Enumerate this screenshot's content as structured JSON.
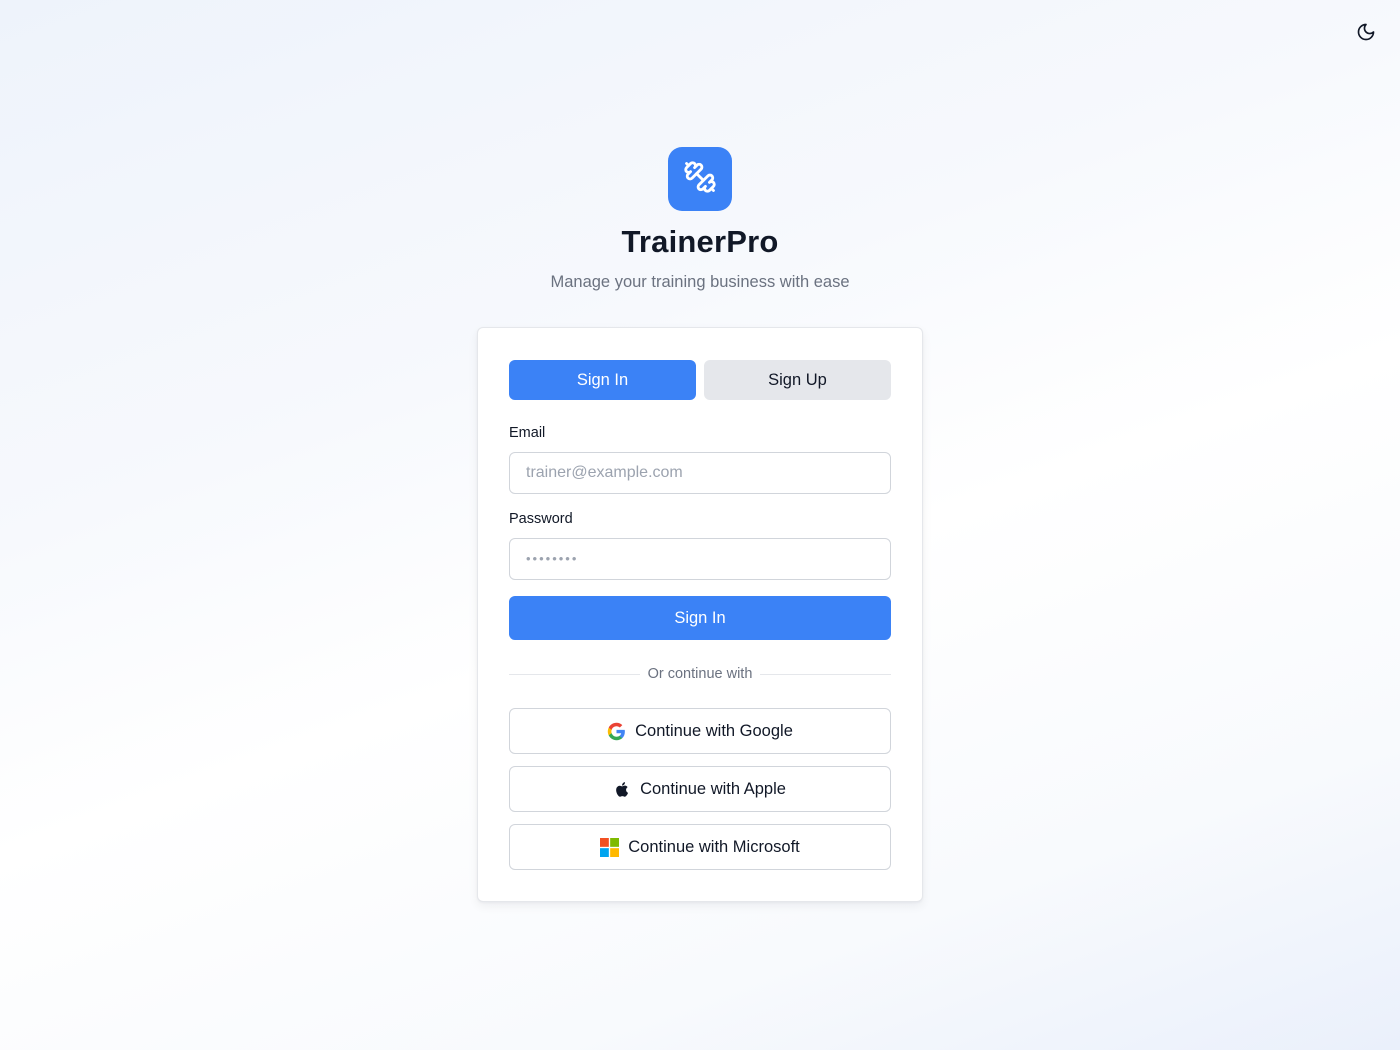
{
  "header": {
    "theme_toggle_icon": "moon-icon"
  },
  "brand": {
    "logo_icon": "dumbbell-icon",
    "logo_color": "#3b82f6",
    "title": "TrainerPro",
    "subtitle": "Manage your training business with ease"
  },
  "auth": {
    "tabs": [
      {
        "label": "Sign In",
        "active": true
      },
      {
        "label": "Sign Up",
        "active": false
      }
    ],
    "email": {
      "label": "Email",
      "placeholder": "trainer@example.com",
      "value": ""
    },
    "password": {
      "label": "Password",
      "placeholder": "••••••••",
      "value": ""
    },
    "submit_label": "Sign In",
    "divider_text": "Or continue with",
    "providers": [
      {
        "label": "Continue with Google",
        "icon": "google-icon"
      },
      {
        "label": "Continue with Apple",
        "icon": "apple-icon"
      },
      {
        "label": "Continue with Microsoft",
        "icon": "microsoft-icon"
      }
    ]
  },
  "colors": {
    "accent": "#3b82f6",
    "secondary_tab": "#e5e7eb"
  }
}
